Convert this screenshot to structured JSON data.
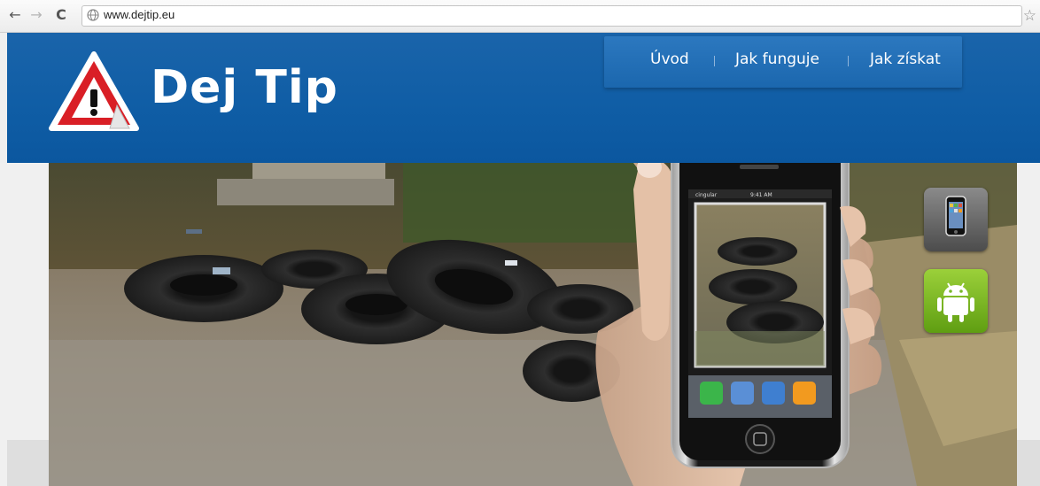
{
  "browser": {
    "back_icon": "back-arrow-icon",
    "forward_icon": "forward-arrow-icon",
    "reload_icon": "reload-icon",
    "url": "www.dejtip.eu",
    "bookmark_icon": "star-icon"
  },
  "site": {
    "logo_text": "Dej Tip",
    "logo_icon": "warning-triangle-icon",
    "nav": {
      "item_1": "Úvod",
      "item_2": "Jak funguje",
      "item_3": "Jak získat"
    },
    "hero": {
      "image_description_icon": "photo-tires-hand-phone",
      "apple_store_icon": "iphone-icon",
      "android_store_icon": "android-icon"
    }
  },
  "colors": {
    "header_blue": "#0f5da5",
    "nav_blue": "#2c78bf",
    "logo_red": "#d91f26",
    "android_green": "#7ab82a"
  }
}
